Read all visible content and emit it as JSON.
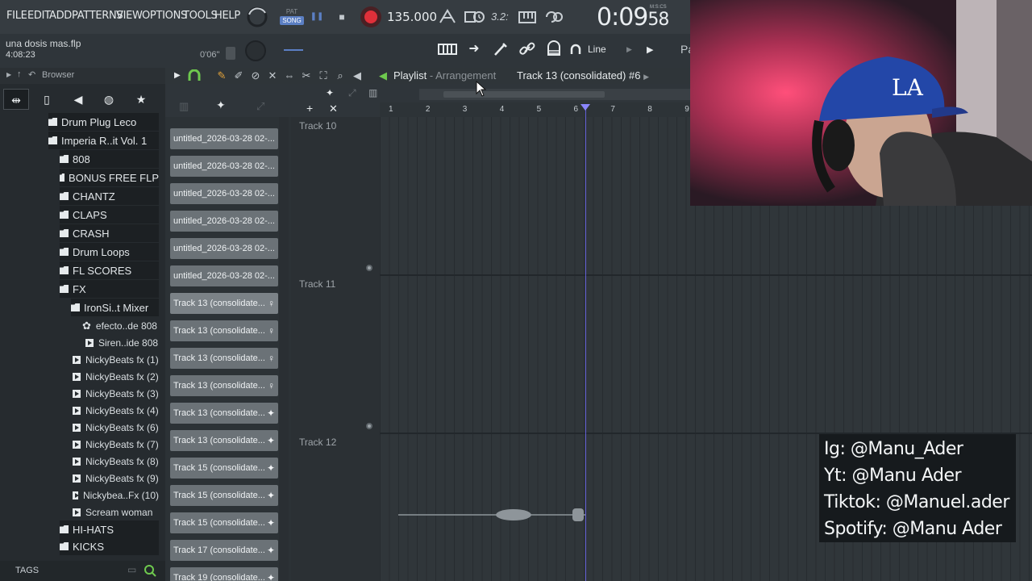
{
  "menu": [
    "FILE",
    "EDIT",
    "ADD",
    "PATTERNS",
    "VIEW",
    "OPTIONS",
    "TOOLS",
    "HELP"
  ],
  "transport": {
    "pat_label": "PAT",
    "song_label": "SONG",
    "tempo": "135.000",
    "meter": "3.2:",
    "time": "0:09",
    "time_fraction": "58",
    "time_unit": "M:S:CS"
  },
  "project": {
    "filename": "una dosis mas.flp",
    "duration": "4:08:23",
    "position": "0'06\""
  },
  "toolbar2": {
    "snap_label": "Line",
    "pa_label": "Pa"
  },
  "browser": {
    "title": "Browser",
    "tags_label": "TAGS",
    "tree": [
      {
        "label": "Drum Plug Leco",
        "kind": "folder",
        "indent": 0
      },
      {
        "label": "Imperia R..it Vol. 1",
        "kind": "folder",
        "indent": 0
      },
      {
        "label": "808",
        "kind": "folder",
        "indent": 1
      },
      {
        "label": "BONUS FREE FLP",
        "kind": "folder",
        "indent": 1
      },
      {
        "label": "CHANTZ",
        "kind": "folder",
        "indent": 1
      },
      {
        "label": "CLAPS",
        "kind": "folder",
        "indent": 1
      },
      {
        "label": "CRASH",
        "kind": "folder",
        "indent": 1
      },
      {
        "label": "Drum Loops",
        "kind": "folder",
        "indent": 1
      },
      {
        "label": "FL SCORES",
        "kind": "folder",
        "indent": 1
      },
      {
        "label": "FX",
        "kind": "folder",
        "indent": 1
      },
      {
        "label": "IronSi..t Mixer",
        "kind": "folder",
        "indent": 2
      },
      {
        "label": "efecto..de 808",
        "kind": "preset",
        "indent": 3
      },
      {
        "label": "Siren..ide 808",
        "kind": "audio",
        "indent": 3
      },
      {
        "label": "NickyBeats fx (1)",
        "kind": "audio",
        "indent": 2
      },
      {
        "label": "NickyBeats fx (2)",
        "kind": "audio",
        "indent": 2
      },
      {
        "label": "NickyBeats fx (3)",
        "kind": "audio",
        "indent": 2
      },
      {
        "label": "NickyBeats fx (4)",
        "kind": "audio",
        "indent": 2
      },
      {
        "label": "NickyBeats fx (6)",
        "kind": "audio",
        "indent": 2
      },
      {
        "label": "NickyBeats fx (7)",
        "kind": "audio",
        "indent": 2
      },
      {
        "label": "NickyBeats fx (8)",
        "kind": "audio",
        "indent": 2
      },
      {
        "label": "NickyBeats fx (9)",
        "kind": "audio",
        "indent": 2
      },
      {
        "label": "Nickybea..Fx (10)",
        "kind": "audio",
        "indent": 2
      },
      {
        "label": "Scream woman",
        "kind": "audio",
        "indent": 2
      },
      {
        "label": "HI-HATS",
        "kind": "folder",
        "indent": 1
      },
      {
        "label": "KICKS",
        "kind": "folder",
        "indent": 1
      }
    ]
  },
  "playlist": {
    "title": "Playlist",
    "separator": "-",
    "subtitle": "Arrangement",
    "current_track": "Track 13 (consolidated) #6"
  },
  "clips": [
    {
      "label": "untitled_2026-03-28 02-...",
      "icon": "none"
    },
    {
      "label": "untitled_2026-03-28 02-...",
      "icon": "none"
    },
    {
      "label": "untitled_2026-03-28 02-...",
      "icon": "none"
    },
    {
      "label": "untitled_2026-03-28 02-...",
      "icon": "none"
    },
    {
      "label": "untitled_2026-03-28 02-...",
      "icon": "none"
    },
    {
      "label": "untitled_2026-03-28 02-...",
      "icon": "none"
    },
    {
      "label": "Track 13 (consolidate...",
      "icon": "lollipop"
    },
    {
      "label": "Track 13 (consolidate...",
      "icon": "lollipop"
    },
    {
      "label": "Track 13 (consolidate...",
      "icon": "lollipop"
    },
    {
      "label": "Track 13 (consolidate...",
      "icon": "lollipop"
    },
    {
      "label": "Track 13 (consolidate...",
      "icon": "wave"
    },
    {
      "label": "Track 13 (consolidate...",
      "icon": "wave"
    },
    {
      "label": "Track 15 (consolidate...",
      "icon": "wave"
    },
    {
      "label": "Track 15 (consolidate...",
      "icon": "wave"
    },
    {
      "label": "Track 15 (consolidate...",
      "icon": "wave"
    },
    {
      "label": "Track 17 (consolidate...",
      "icon": "wave"
    },
    {
      "label": "Track 19 (consolidate...",
      "icon": "wave"
    }
  ],
  "tracks": [
    "Track 10",
    "Track 11",
    "Track 12"
  ],
  "ruler": [
    "1",
    "2",
    "3",
    "4",
    "5",
    "6",
    "7",
    "8",
    "9"
  ],
  "socials": [
    "Ig: @Manu_Ader",
    "Yt: @Manu Ader",
    "Tiktok: @Manuel.ader",
    "Spotify: @Manu Ader"
  ],
  "colors": {
    "record": "#e0303a",
    "song_active": "#5b7fc4",
    "playhead": "#6f6aff",
    "play_green": "#6ec94e"
  }
}
